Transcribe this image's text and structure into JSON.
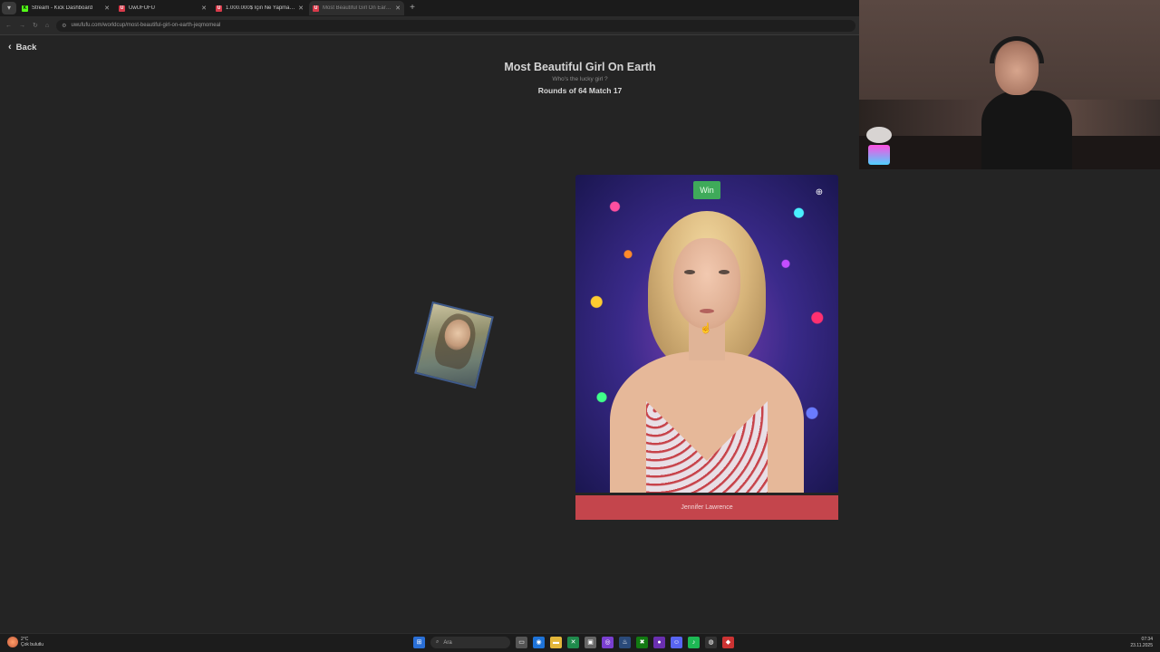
{
  "browser": {
    "menu_icon": "chevron-down-icon",
    "tabs": [
      {
        "label": "Stream - Kick Dashboard",
        "fav": "K",
        "fav_color": "#53fc18",
        "active": false
      },
      {
        "label": "UwUFUFU",
        "fav": "U",
        "fav_color": "#d83a4a",
        "active": false
      },
      {
        "label": "1.000.000$ İçin Ne Yapmazsın! -",
        "fav": "U",
        "fav_color": "#d83a4a",
        "active": false
      },
      {
        "label": "Most Beautiful Girl On Earth! -",
        "fav": "U",
        "fav_color": "#d83a4a",
        "active": true
      }
    ],
    "new_tab": "+",
    "url": "uwufufu.com/worldcup/most-beautiful-girl-on-earth-jeqmomeal"
  },
  "page": {
    "back_label": "Back",
    "title": "Most Beautiful Girl On Earth",
    "subtitle": "Who's the lucky girl ?",
    "round_info": "Rounds of 64 Match 17",
    "winner": {
      "badge": "Win",
      "name": "Jennifer Lawrence"
    }
  },
  "taskbar": {
    "weather_temp": "2°C",
    "weather_desc": "Çok bulutlu",
    "search_placeholder": "Ara",
    "time": "07:34",
    "date": "23.11.2025"
  },
  "colors": {
    "accent_win": "#3faa5a",
    "name_bar": "#c4454c",
    "background": "#242424"
  }
}
